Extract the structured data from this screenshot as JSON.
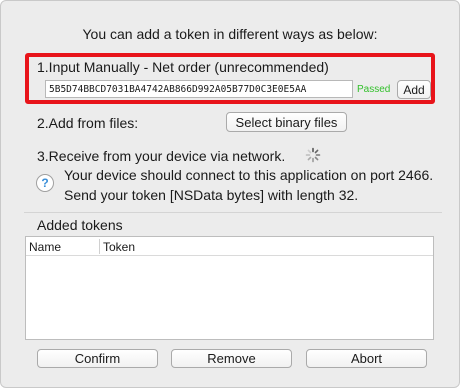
{
  "intro_text": "You can add a token in different ways as below:",
  "manual": {
    "label": "1.Input Manually - Net order (unrecommended)",
    "token_value": "5B5D74BBCD7031BA4742AB866D992A05B77D0C3E0E5AA",
    "status": "Passed",
    "status_color": "#33c02c",
    "add_label": "Add",
    "highlight_color": "#e8141a"
  },
  "files": {
    "label": "2.Add from files:",
    "select_label": "Select binary files"
  },
  "network": {
    "label": "3.Receive from your device via network.",
    "line1": "Your device should connect to this application on port 2466.",
    "line2": "Send your token [NSData bytes] with length 32.",
    "help_glyph": "?",
    "spinner_icon": "loading-spinner-icon"
  },
  "added": {
    "title": "Added tokens",
    "columns": [
      "Name",
      "Token"
    ]
  },
  "buttons": {
    "confirm": "Confirm",
    "remove": "Remove",
    "abort": "Abort"
  }
}
